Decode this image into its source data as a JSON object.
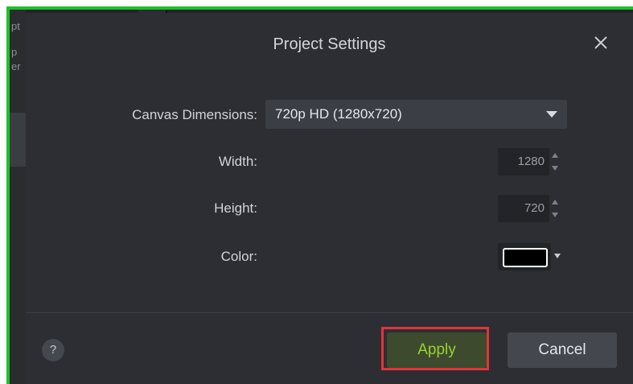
{
  "background": {
    "left_fragments": [
      "pt",
      "p",
      "er"
    ]
  },
  "dialog": {
    "title": "Project Settings",
    "close_icon": "close-icon",
    "canvas_dimensions": {
      "label": "Canvas Dimensions:",
      "value": "720p HD (1280x720)"
    },
    "width": {
      "label": "Width:",
      "value": "1280"
    },
    "height": {
      "label": "Height:",
      "value": "720"
    },
    "color": {
      "label": "Color:",
      "value": "#000000"
    },
    "help_label": "?",
    "apply_label": "Apply",
    "cancel_label": "Cancel"
  },
  "colors": {
    "frame_green": "#1fbf2a",
    "dialog_bg": "#2c2e33",
    "apply_text": "#9bd22e",
    "highlight": "#e0353a"
  }
}
